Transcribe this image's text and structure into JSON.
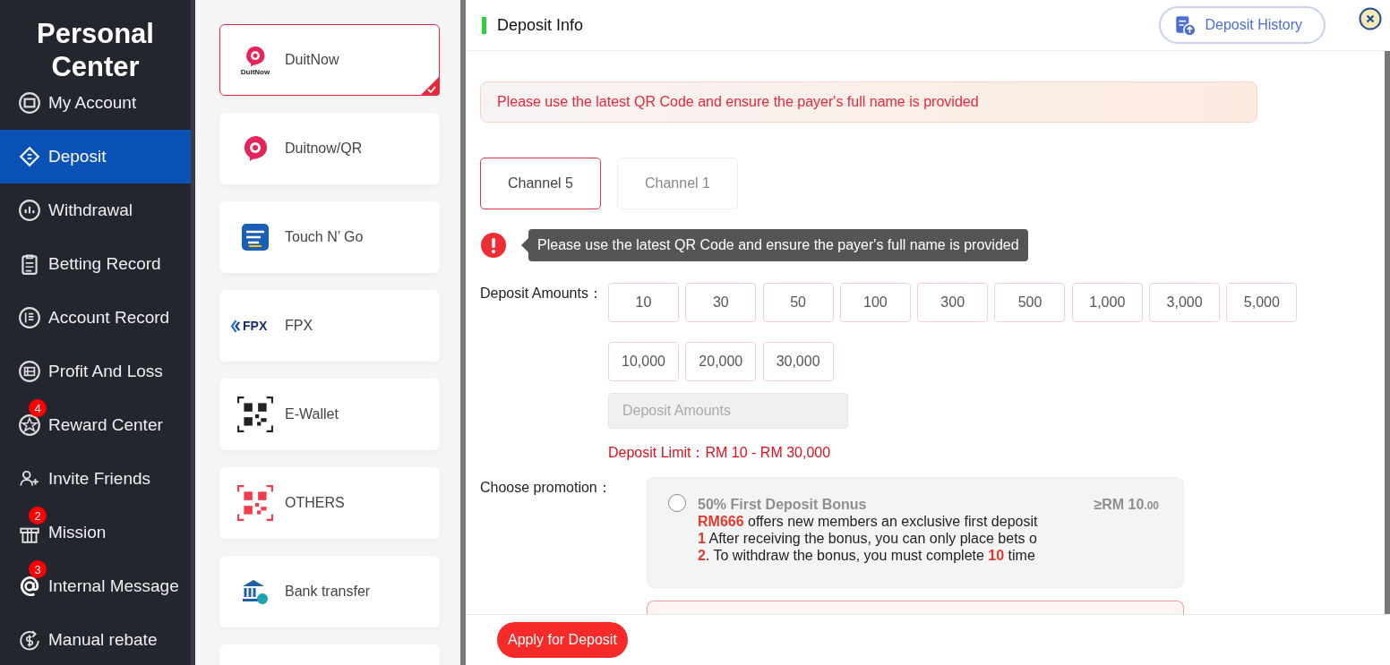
{
  "sidebar": {
    "title": "Personal Center",
    "items": [
      {
        "label": "My Account",
        "selected": false
      },
      {
        "label": "Deposit",
        "selected": true
      },
      {
        "label": "Withdrawal",
        "selected": false
      },
      {
        "label": "Betting Record",
        "selected": false
      },
      {
        "label": "Account Record",
        "selected": false
      },
      {
        "label": "Profit And Loss",
        "selected": false
      },
      {
        "label": "Reward Center",
        "selected": false,
        "badge": "4"
      },
      {
        "label": "Invite Friends",
        "selected": false
      },
      {
        "label": "Mission",
        "selected": false,
        "badge": "2"
      },
      {
        "label": "Internal Message",
        "selected": false,
        "badge": "3"
      },
      {
        "label": "Manual rebate",
        "selected": false
      }
    ]
  },
  "methods": [
    {
      "label": "DuitNow",
      "logo_text": "DuitNow",
      "selected": true
    },
    {
      "label": "Duitnow/QR",
      "selected": false
    },
    {
      "label": "Touch N’ Go",
      "selected": false
    },
    {
      "label": "FPX",
      "logo_text": "FPX",
      "selected": false
    },
    {
      "label": "E-Wallet",
      "selected": false
    },
    {
      "label": "OTHERS",
      "selected": false
    },
    {
      "label": "Bank transfer",
      "selected": false
    },
    {
      "selected": false
    }
  ],
  "header": {
    "title": "Deposit Info",
    "history_button": "Deposit History"
  },
  "notice": "Please use the latest QR Code and ensure the payer's full name is provided",
  "channels": [
    {
      "label": "Channel 5",
      "selected": true
    },
    {
      "label": "Channel 1",
      "selected": false
    }
  ],
  "tooltip": "Please use the latest QR Code and ensure the payer's full name is provided",
  "amounts": {
    "label": "Deposit Amounts：",
    "options": [
      "10",
      "30",
      "50",
      "100",
      "300",
      "500",
      "1,000",
      "3,000",
      "5,000",
      "10,000",
      "20,000",
      "30,000"
    ],
    "placeholder": "Deposit Amounts",
    "limit": "Deposit Limit：RM  10  - RM  30,000"
  },
  "promotion": {
    "label": "Choose promotion：",
    "more_below": true,
    "cards": [
      {
        "title": "50% First Deposit Bonus",
        "min_amount": "≥RM  10",
        "min_decimals": ".00",
        "selected": false,
        "lines": [
          "**RM666** offers new members an exclusive first deposit",
          "**1** After receiving the bonus, you can only place bets o",
          "**2**. To withdraw the bonus, you must complete  **10** time"
        ]
      }
    ]
  },
  "footer": {
    "apply_button": "Apply for Deposit"
  }
}
